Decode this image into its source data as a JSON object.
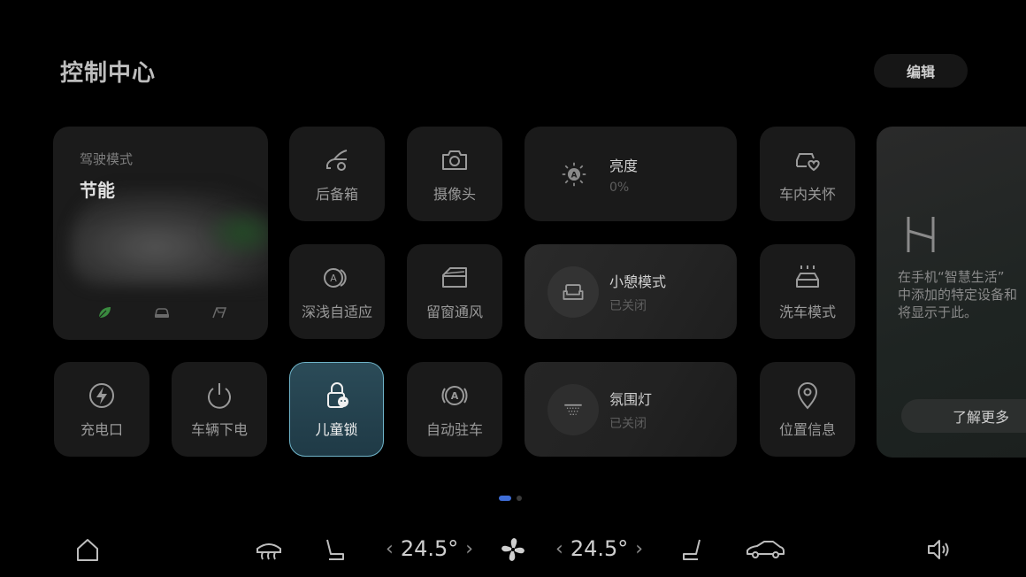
{
  "header": {
    "title": "控制中心",
    "edit_label": "编辑"
  },
  "drive_mode": {
    "caption": "驾驶模式",
    "value": "节能",
    "modes": [
      "eco-leaf-icon",
      "comfort-car-icon",
      "sport-flag-icon"
    ],
    "accent": "#3a8a3f"
  },
  "tiles": {
    "trunk": "后备箱",
    "camera": "摄像头",
    "car_care": "车内关怀",
    "adaptive_depth": "深浅自适应",
    "window_vent": "留窗通风",
    "car_wash": "洗车模式",
    "charge_port": "充电口",
    "power_off": "车辆下电",
    "child_lock": "儿童锁",
    "auto_hold": "自动驻车",
    "location": "位置信息"
  },
  "brightness": {
    "title": "亮度",
    "value": "0%"
  },
  "rest_mode": {
    "title": "小憩模式",
    "status": "已关闭"
  },
  "ambient_light": {
    "title": "氛围灯",
    "status": "已关闭"
  },
  "smart_life": {
    "line1": "在手机“智慧生活”",
    "line2": "中添加的特定设备和",
    "line3": "将显示于此。",
    "more_label": "了解更多"
  },
  "dock": {
    "temp_left": "24.5°",
    "temp_right": "24.5°"
  },
  "colors": {
    "highlight_border": "#6fb4c9",
    "pager_active": "#3f6ed8"
  }
}
